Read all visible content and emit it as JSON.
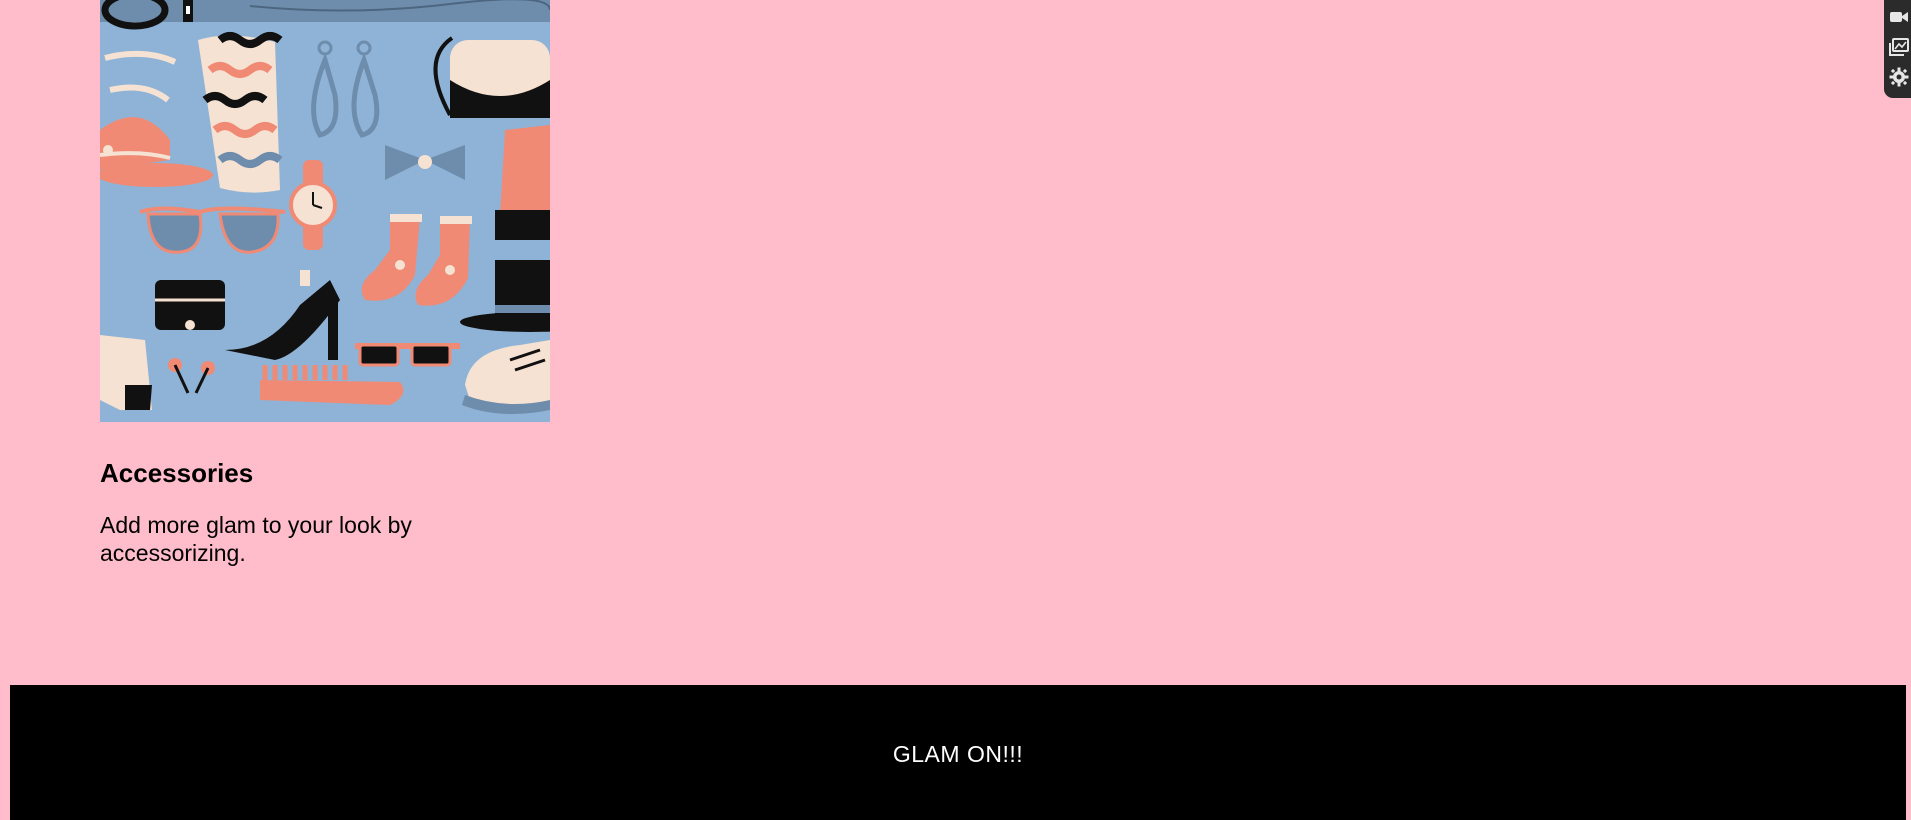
{
  "card": {
    "title": "Accessories",
    "description": "Add more glam to your look by accessorizing."
  },
  "footer": {
    "text": "GLAM ON!!!"
  },
  "colors": {
    "page_background": "#FFBCCB",
    "footer_background": "#000000",
    "footer_text": "#FFFFFF",
    "illustration_background": "#8FB3D6",
    "illustration_salmon": "#F08A74",
    "illustration_cream": "#F6E2D2",
    "illustration_slate": "#6E8DAC"
  },
  "side_toolbar": {
    "icons": [
      "video-camera-icon",
      "image-gallery-icon",
      "gear-icon"
    ]
  }
}
